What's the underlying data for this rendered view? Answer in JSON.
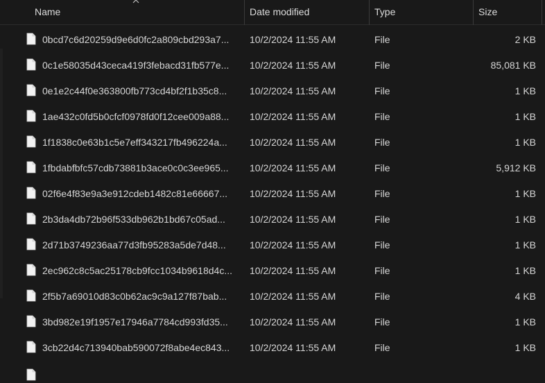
{
  "columns": {
    "name": "Name",
    "date": "Date modified",
    "type": "Type",
    "size": "Size"
  },
  "icons": {
    "sort": "chevron-up-icon",
    "file": "file-icon"
  },
  "colors": {
    "background": "#191919",
    "text": "#d6d6d6",
    "header_text": "#dcdcdc",
    "divider": "#3a3a3a"
  },
  "files": [
    {
      "name": "0bcd7c6d20259d9e6d0fc2a809cbd293a7...",
      "date": "10/2/2024 11:55 AM",
      "type": "File",
      "size": "2 KB"
    },
    {
      "name": "0c1e58035d43ceca419f3febacd31fb577e...",
      "date": "10/2/2024 11:55 AM",
      "type": "File",
      "size": "85,081 KB"
    },
    {
      "name": "0e1e2c44f0e363800fb773cd4bf2f1b35c8...",
      "date": "10/2/2024 11:55 AM",
      "type": "File",
      "size": "1 KB"
    },
    {
      "name": "1ae432c0fd5b0cfcf0978fd0f12cee009a88...",
      "date": "10/2/2024 11:55 AM",
      "type": "File",
      "size": "1 KB"
    },
    {
      "name": "1f1838c0e63b1c5e7eff343217fb496224a...",
      "date": "10/2/2024 11:55 AM",
      "type": "File",
      "size": "1 KB"
    },
    {
      "name": "1fbdabfbfc57cdb73881b3ace0c0c3ee965...",
      "date": "10/2/2024 11:55 AM",
      "type": "File",
      "size": "5,912 KB"
    },
    {
      "name": "02f6e4f83e9a3e912cdeb1482c81e66667...",
      "date": "10/2/2024 11:55 AM",
      "type": "File",
      "size": "1 KB"
    },
    {
      "name": "2b3da4db72b96f533db962b1bd67c05ad...",
      "date": "10/2/2024 11:55 AM",
      "type": "File",
      "size": "1 KB"
    },
    {
      "name": "2d71b3749236aa77d3fb95283a5de7d48...",
      "date": "10/2/2024 11:55 AM",
      "type": "File",
      "size": "1 KB"
    },
    {
      "name": "2ec962c8c5ac25178cb9fcc1034b9618d4c...",
      "date": "10/2/2024 11:55 AM",
      "type": "File",
      "size": "1 KB"
    },
    {
      "name": "2f5b7a69010d83c0b62ac9c9a127f87bab...",
      "date": "10/2/2024 11:55 AM",
      "type": "File",
      "size": "4 KB"
    },
    {
      "name": "3bd982e19f1957e17946a7784cd993fd35...",
      "date": "10/2/2024 11:55 AM",
      "type": "File",
      "size": "1 KB"
    },
    {
      "name": "3cb22d4c713940bab590072f8abe4ec843...",
      "date": "10/2/2024 11:55 AM",
      "type": "File",
      "size": "1 KB"
    }
  ]
}
